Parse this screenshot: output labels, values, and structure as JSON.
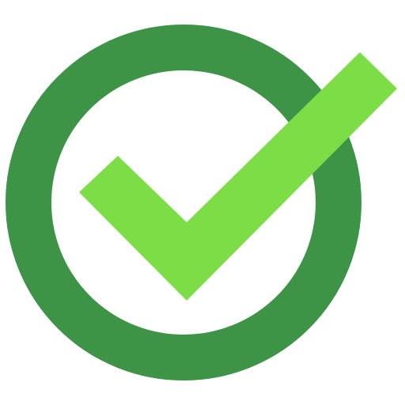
{
  "icon": {
    "name": "check-circle-icon",
    "ring_color": "#3d9447",
    "check_color": "#7ddd47",
    "background_color": "#ffffff"
  }
}
